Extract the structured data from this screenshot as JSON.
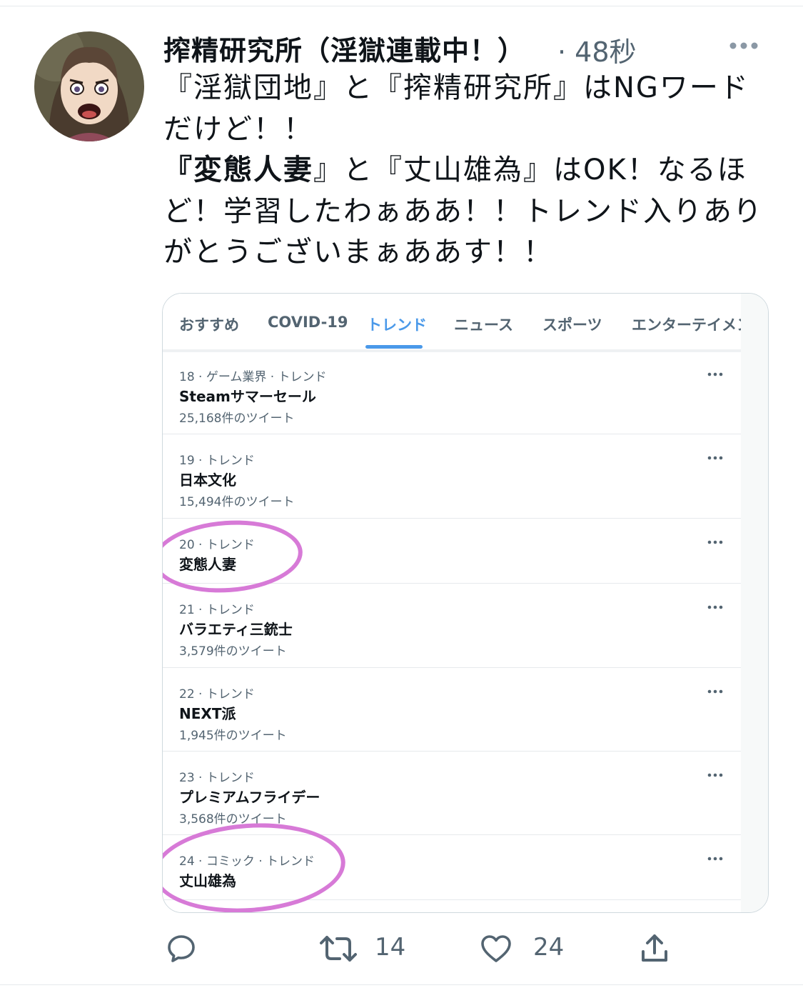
{
  "tweet": {
    "display_name": "搾精研究所（淫獄連載中！）",
    "timestamp": "· 48秒",
    "text_lines": [
      {
        "plain": "『淫獄団地』と『搾精研究所』はNGワード"
      },
      {
        "plain": "だけど！！"
      },
      {
        "bold": "『変態人妻",
        "plain": "』と『丈山雄為』はOK！なるほ"
      },
      {
        "plain": "ど！学習したわぁああ！！トレンド入りあり"
      },
      {
        "plain": "がとうございまぁああす！！"
      }
    ]
  },
  "embedded_screenshot": {
    "tabs": [
      {
        "label": "おすすめ",
        "active": false
      },
      {
        "label": "COVID-19",
        "active": false
      },
      {
        "label": "トレンド",
        "active": true
      },
      {
        "label": "ニュース",
        "active": false
      },
      {
        "label": "スポーツ",
        "active": false
      },
      {
        "label": "エンターテイメン",
        "active": false
      }
    ],
    "trends": [
      {
        "meta": "18 · ゲーム業界 · トレンド",
        "name": "Steamサマーセール",
        "count": "25,168件のツイート",
        "highlighted": false
      },
      {
        "meta": "19 · トレンド",
        "name": "日本文化",
        "count": "15,494件のツイート",
        "highlighted": false
      },
      {
        "meta": "20 · トレンド",
        "name": "変態人妻",
        "count": "",
        "highlighted": true
      },
      {
        "meta": "21 · トレンド",
        "name": "バラエティ三銃士",
        "count": "3,579件のツイート",
        "highlighted": false
      },
      {
        "meta": "22 · トレンド",
        "name": "NEXT派",
        "count": "1,945件のツイート",
        "highlighted": false
      },
      {
        "meta": "23 · トレンド",
        "name": "プレミアムフライデー",
        "count": "3,568件のツイート",
        "highlighted": false
      },
      {
        "meta": "24 · コミック · トレンド",
        "name": "丈山雄為",
        "count": "",
        "highlighted": true
      }
    ],
    "highlight_color": "#d77ad7",
    "active_tab_color": "#4a99e9"
  },
  "actions": {
    "reply_icon": "reply-icon",
    "retweet_icon": "retweet-icon",
    "retweet_count": "14",
    "like_icon": "heart-icon",
    "like_count": "24",
    "share_icon": "share-icon"
  },
  "colors": {
    "secondary_text": "#536471",
    "icon_gray": "#536471"
  }
}
